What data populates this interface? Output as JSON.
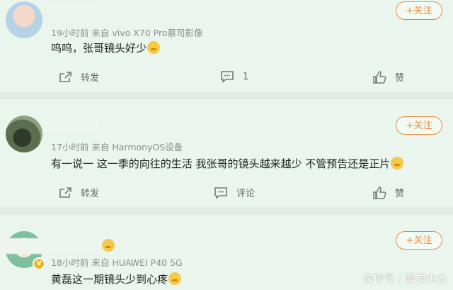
{
  "comments": [
    {
      "meta": "19小时前 来自 vivo X70 Pro蔡司影像",
      "content": "呜呜，张哥镜头好少",
      "follow_label": "+关注",
      "share_label": "转发",
      "comment_label": "1",
      "like_label": "赞"
    },
    {
      "meta": "17小时前 来自 HarmonyOS设备",
      "content": "有一说一 这一季的向往的生活 我张哥的镜头越来越少 不管预告还是正片",
      "follow_label": "+关注",
      "share_label": "转发",
      "comment_label": "评论",
      "like_label": "赞"
    },
    {
      "meta": "18小时前 来自 HUAWEI P40 5G",
      "content": "黄磊这一期镜头少到心疼",
      "follow_label": "+关注"
    }
  ],
  "watermark": "快传号 / 萌神木木",
  "colors": {
    "accent": "#f08a3d",
    "background": "#eaf5ed"
  }
}
